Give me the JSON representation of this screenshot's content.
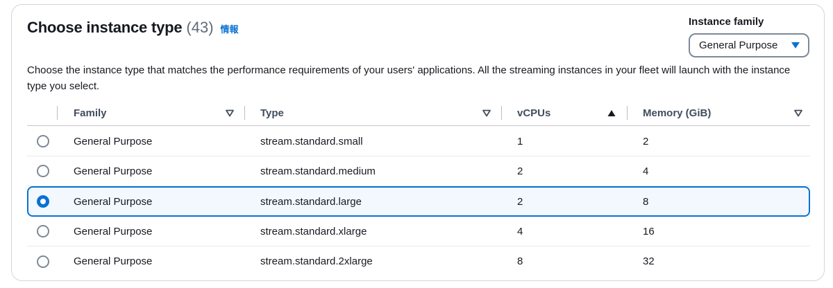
{
  "header": {
    "title": "Choose instance type",
    "count": "(43)",
    "info_link": "情報"
  },
  "filter": {
    "label": "Instance family",
    "selected": "General Purpose"
  },
  "description": "Choose the instance type that matches the performance requirements of your users' applications. All the streaming instances in your fleet will launch with the instance type you select.",
  "table": {
    "columns": [
      "Family",
      "Type",
      "vCPUs",
      "Memory (GiB)"
    ],
    "sort": {
      "column": "vCPUs",
      "direction": "ascending"
    },
    "rows": [
      {
        "family": "General Purpose",
        "type": "stream.standard.small",
        "vcpus": "1",
        "memory": "2",
        "selected": false
      },
      {
        "family": "General Purpose",
        "type": "stream.standard.medium",
        "vcpus": "2",
        "memory": "4",
        "selected": false
      },
      {
        "family": "General Purpose",
        "type": "stream.standard.large",
        "vcpus": "2",
        "memory": "8",
        "selected": true
      },
      {
        "family": "General Purpose",
        "type": "stream.standard.xlarge",
        "vcpus": "4",
        "memory": "16",
        "selected": false
      },
      {
        "family": "General Purpose",
        "type": "stream.standard.2xlarge",
        "vcpus": "8",
        "memory": "32",
        "selected": false
      }
    ]
  },
  "colors": {
    "accent": "#0972d3",
    "selected_row_bg": "#f2f8fd"
  }
}
